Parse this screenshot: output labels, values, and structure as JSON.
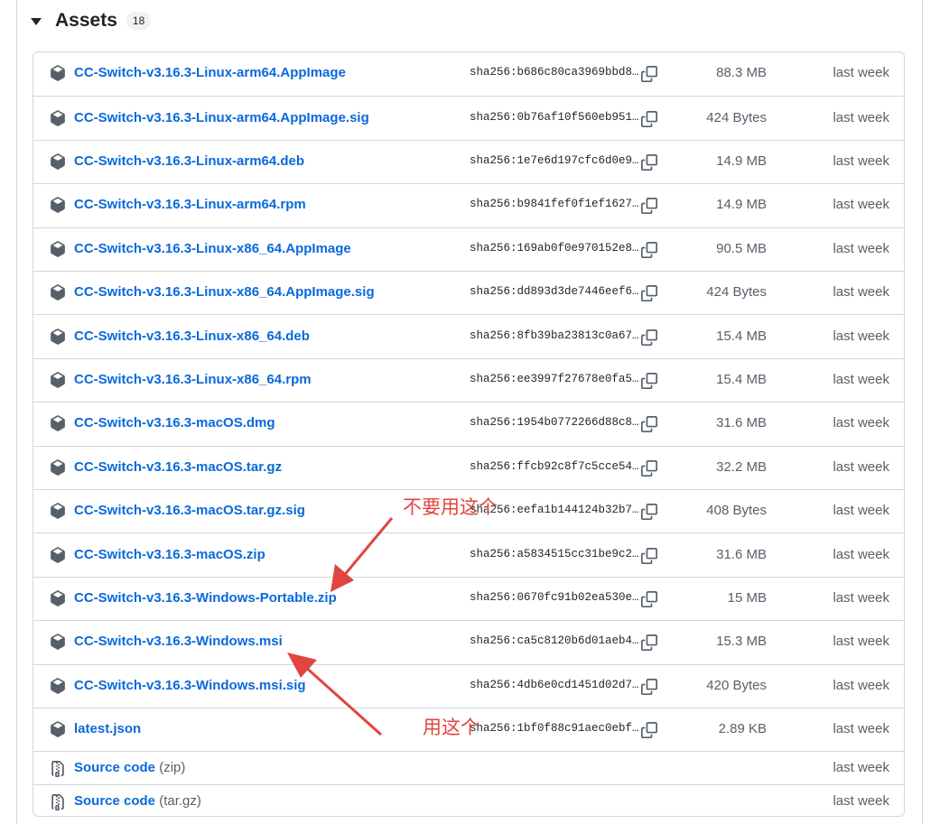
{
  "header": {
    "title": "Assets",
    "count": "18"
  },
  "icons": {
    "package": "package-icon",
    "file_zip": "file-zip-icon",
    "copy": "copy-icon",
    "caret": "triangle-down-icon"
  },
  "colors": {
    "link": "#0969da",
    "muted": "#57606a",
    "border": "#d0d7de",
    "annotation": "#e0453f"
  },
  "assets": [
    {
      "name": "CC-Switch-v3.16.3-Linux-arm64.AppImage",
      "sha": "sha256:b686c80ca3969bbd8…",
      "size": "88.3 MB",
      "date": "last week"
    },
    {
      "name": "CC-Switch-v3.16.3-Linux-arm64.AppImage.sig",
      "sha": "sha256:0b76af10f560eb951…",
      "size": "424 Bytes",
      "date": "last week"
    },
    {
      "name": "CC-Switch-v3.16.3-Linux-arm64.deb",
      "sha": "sha256:1e7e6d197cfc6d0e9…",
      "size": "14.9 MB",
      "date": "last week"
    },
    {
      "name": "CC-Switch-v3.16.3-Linux-arm64.rpm",
      "sha": "sha256:b9841fef0f1ef1627…",
      "size": "14.9 MB",
      "date": "last week"
    },
    {
      "name": "CC-Switch-v3.16.3-Linux-x86_64.AppImage",
      "sha": "sha256:169ab0f0e970152e8…",
      "size": "90.5 MB",
      "date": "last week"
    },
    {
      "name": "CC-Switch-v3.16.3-Linux-x86_64.AppImage.sig",
      "sha": "sha256:dd893d3de7446eef6…",
      "size": "424 Bytes",
      "date": "last week"
    },
    {
      "name": "CC-Switch-v3.16.3-Linux-x86_64.deb",
      "sha": "sha256:8fb39ba23813c0a67…",
      "size": "15.4 MB",
      "date": "last week"
    },
    {
      "name": "CC-Switch-v3.16.3-Linux-x86_64.rpm",
      "sha": "sha256:ee3997f27678e0fa5…",
      "size": "15.4 MB",
      "date": "last week"
    },
    {
      "name": "CC-Switch-v3.16.3-macOS.dmg",
      "sha": "sha256:1954b0772266d88c8…",
      "size": "31.6 MB",
      "date": "last week"
    },
    {
      "name": "CC-Switch-v3.16.3-macOS.tar.gz",
      "sha": "sha256:ffcb92c8f7c5cce54…",
      "size": "32.2 MB",
      "date": "last week"
    },
    {
      "name": "CC-Switch-v3.16.3-macOS.tar.gz.sig",
      "sha": "sha256:eefa1b144124b32b7…",
      "size": "408 Bytes",
      "date": "last week"
    },
    {
      "name": "CC-Switch-v3.16.3-macOS.zip",
      "sha": "sha256:a5834515cc31be9c2…",
      "size": "31.6 MB",
      "date": "last week"
    },
    {
      "name": "CC-Switch-v3.16.3-Windows-Portable.zip",
      "sha": "sha256:0670fc91b02ea530e…",
      "size": "15 MB",
      "date": "last week"
    },
    {
      "name": "CC-Switch-v3.16.3-Windows.msi",
      "sha": "sha256:ca5c8120b6d01aeb4…",
      "size": "15.3 MB",
      "date": "last week"
    },
    {
      "name": "CC-Switch-v3.16.3-Windows.msi.sig",
      "sha": "sha256:4db6e0cd1451d02d7…",
      "size": "420 Bytes",
      "date": "last week"
    },
    {
      "name": "latest.json",
      "sha": "sha256:1bf0f88c91aec0ebf…",
      "size": "2.89 KB",
      "date": "last week"
    }
  ],
  "source_code": [
    {
      "label": "Source code",
      "suffix": "(zip)",
      "date": "last week"
    },
    {
      "label": "Source code",
      "suffix": "(tar.gz)",
      "date": "last week"
    }
  ],
  "annotations": {
    "dont_use": "不要用这个",
    "use_this": "用这个"
  }
}
